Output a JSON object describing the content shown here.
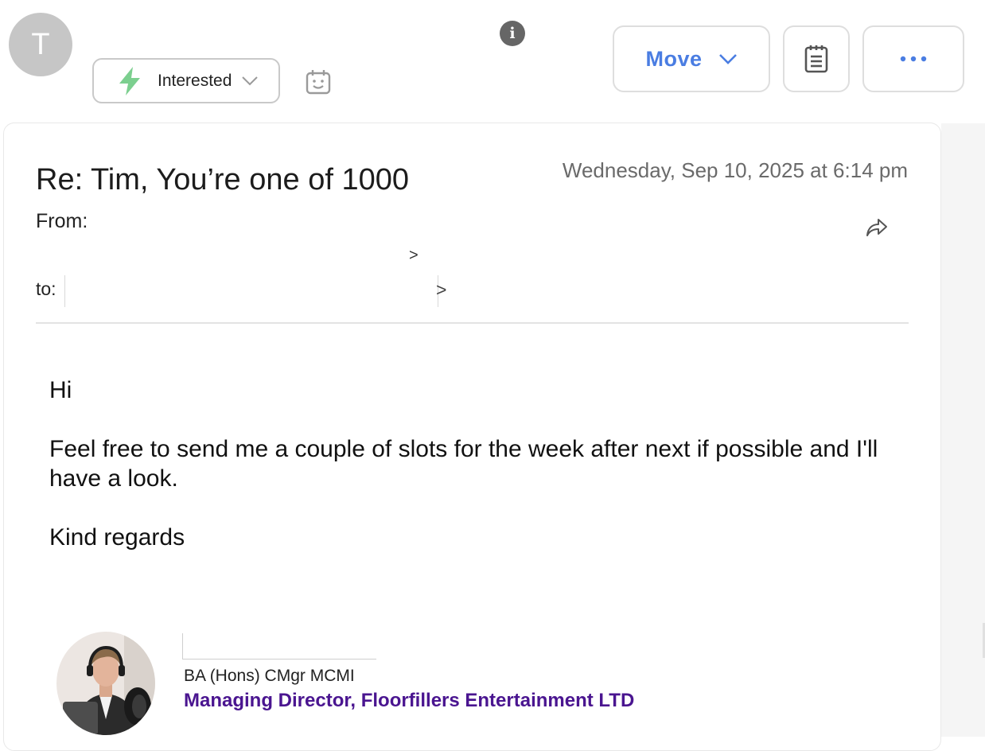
{
  "header": {
    "avatar_letter": "T",
    "status": {
      "label": "Interested",
      "icon": "lightning-bolt-icon",
      "icon_color": "#7ccf8f"
    },
    "move_button": {
      "label": "Move",
      "color": "#4a7de2"
    },
    "icons": {
      "schedule": "schedule-face-icon",
      "info": "info-icon",
      "notes": "clipboard-icon",
      "more": "more-dots-icon"
    }
  },
  "email": {
    "subject": "Re: Tim, You’re one of 1000",
    "date": "Wednesday, Sep 10, 2025 at 6:14 pm",
    "from_label": "From:",
    "from_end": ">",
    "to_label": "to:",
    "to_end": ">",
    "body": {
      "greeting": "Hi",
      "paragraph": "Feel free to send me a couple of slots for the week after next if possible and I'll have a look.",
      "closing": "Kind regards"
    },
    "signature": {
      "credentials": "BA (Hons) CMgr MCMI",
      "role": "Managing Director, Floorfillers Entertainment LTD",
      "role_color": "#4a1590"
    }
  }
}
